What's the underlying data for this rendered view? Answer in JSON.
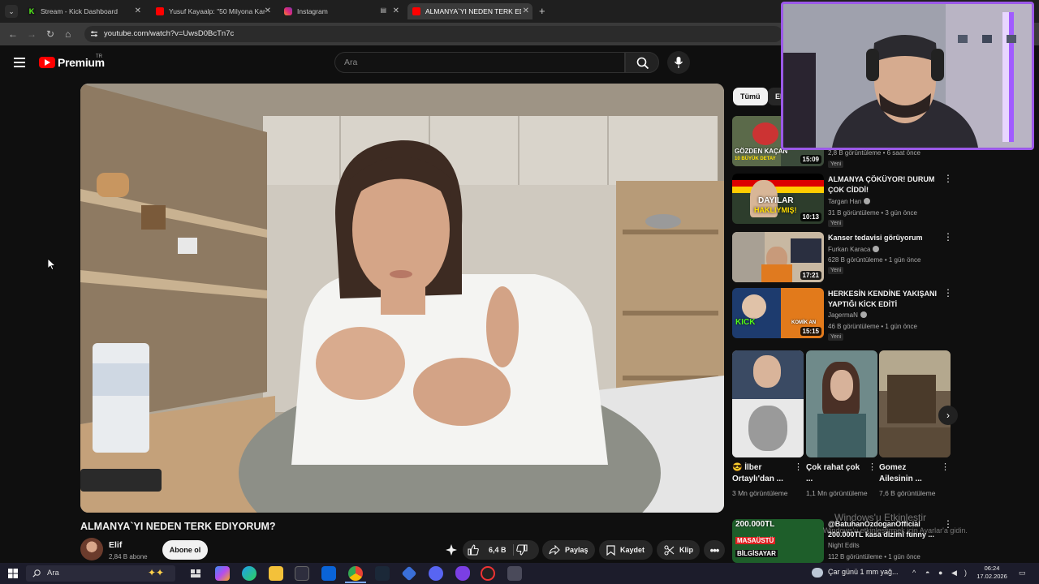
{
  "browser": {
    "tabs": [
      {
        "label": "Stream - Kick Dashboard",
        "active": false,
        "favicon_color": "#53fc18"
      },
      {
        "label": "Yusuf Kayaalp: \"50 Milyona Kar",
        "active": false,
        "favicon_color": "#ff0000"
      },
      {
        "label": "Instagram",
        "active": false,
        "favicon_color": "#e1306c"
      },
      {
        "label": "ALMANYA`YI NEDEN TERK EDİYO",
        "active": true,
        "favicon_color": "#ff0000"
      }
    ],
    "url": "youtube.com/watch?v=UwsD0BcTn7c"
  },
  "header": {
    "brand": "Premium",
    "region": "TR",
    "search_placeholder": "Ara"
  },
  "video": {
    "title": "ALMANYA`YI NEDEN TERK EDIYORUM?",
    "channel": "Elif",
    "subscribers": "2,84 B abone",
    "subscribe_label": "Abone ol",
    "likes": "6,4 B",
    "share_label": "Paylaş",
    "save_label": "Kaydet",
    "clip_label": "Klip"
  },
  "sidebar": {
    "chips": [
      "Tümü",
      "Eli"
    ],
    "recommendations": [
      {
        "title": "",
        "channel": "",
        "meta": "2,8 B görüntüleme • 6 saat önce",
        "badge": "Yeni",
        "duration": "15:09",
        "thumb_text": "GÖZDEN KAÇAN",
        "thumb_text2": "10 BÜYÜK DETAY"
      },
      {
        "title": "ALMANYA ÇÖKÜYOR! DURUM ÇOK CİDDİ!",
        "channel": "Targan Han",
        "meta": "31 B görüntüleme • 3 gün önce",
        "badge": "Yeni",
        "duration": "10:13",
        "thumb_text": "DAYILAR",
        "thumb_text2": "HAKLIYMIŞ!"
      },
      {
        "title": "Kanser tedavisi görüyorum",
        "channel": "Furkan Karaca",
        "meta": "628 B görüntüleme • 1 gün önce",
        "badge": "Yeni",
        "duration": "17:21",
        "thumb_text": "",
        "thumb_text2": ""
      },
      {
        "title": "HERKESİN KENDİNE YAKIŞANI YAPTIĞI KİCK EDİTİ",
        "channel": "JagermaN",
        "meta": "46 B görüntüleme • 1 gün önce",
        "badge": "Yeni",
        "duration": "15:15",
        "thumb_text": "KICK",
        "thumb_text2": "KOMİK AN"
      }
    ],
    "shorts": [
      {
        "title": "😎 İlber Ortaylı'dan ...",
        "views": "3 Mn görüntüleme"
      },
      {
        "title": "Çok rahat çok ...",
        "views": "1,1 Mn görüntüleme"
      },
      {
        "title": "Gomez Ailesinin ...",
        "views": "7,6 B görüntüleme"
      }
    ],
    "last_rec": {
      "title": "@BatuhanOzdoganOfficial 200.000TL kasa dizimi funny ...",
      "channel": "Night Edits",
      "meta": "112 B görüntüleme • 1 gün önce",
      "thumb_text": "200.000TL",
      "thumb_text2": "MASAÜSTÜ",
      "thumb_text3": "BİLGİSAYAR"
    }
  },
  "windows": {
    "watermark_title": "Windows'u Etkinleştir",
    "watermark_sub": "Windows'u etkinleştirmek için Ayarlar'a gidin.",
    "search_label": "Ara",
    "weather": "Çar günü 1 mm yağ...",
    "time": "06:24",
    "date": "17.02.2026"
  },
  "colors": {
    "yt_red": "#ff0000",
    "cam_border": "#9b59e8",
    "bg": "#0f0f0f"
  }
}
